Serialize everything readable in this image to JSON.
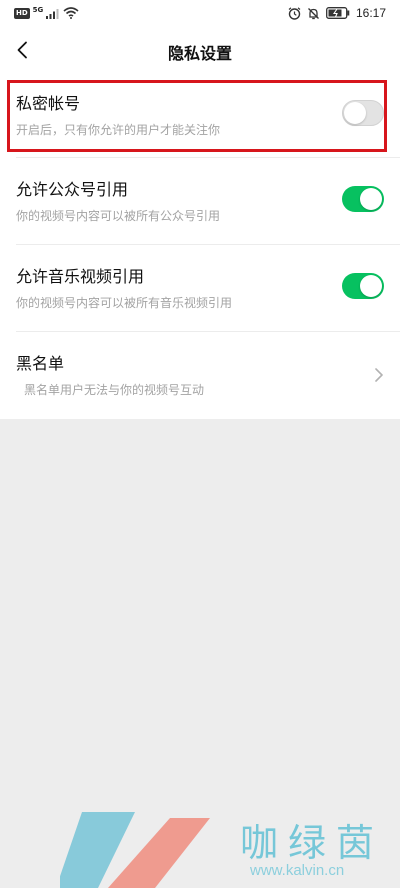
{
  "status_bar": {
    "network_badge": "HD",
    "signal_label": "5G",
    "time": "16:17"
  },
  "header": {
    "title": "隐私设置",
    "back_icon": "chevron-left-icon"
  },
  "settings": {
    "private_account": {
      "title": "私密帐号",
      "description": "开启后，只有你允许的用户才能关注你",
      "enabled": false
    },
    "allow_official": {
      "title": "允许公众号引用",
      "description": "你的视频号内容可以被所有公众号引用",
      "enabled": true
    },
    "allow_music": {
      "title": "允许音乐视频引用",
      "description": "你的视频号内容可以被所有音乐视频引用",
      "enabled": true
    },
    "blacklist": {
      "title": "黑名单",
      "description": "黑名单用户无法与你的视频号互动"
    }
  },
  "colors": {
    "toggle_on": "#07c160",
    "toggle_off": "#e3e3e3",
    "highlight": "#d7161c",
    "background": "#ededed"
  },
  "watermark": {
    "title": "咖绿茵",
    "url": "www.kalvin.cn"
  }
}
